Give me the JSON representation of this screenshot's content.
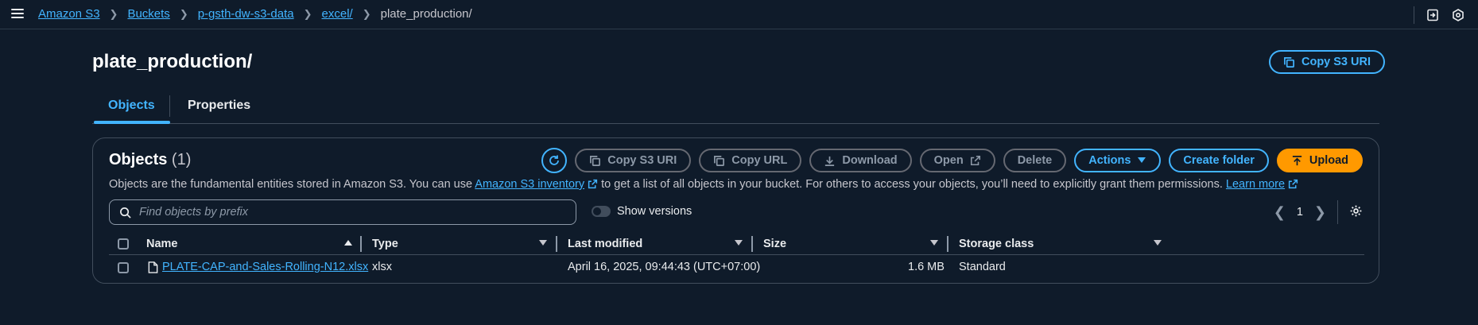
{
  "breadcrumbs": [
    {
      "label": "Amazon S3"
    },
    {
      "label": "Buckets"
    },
    {
      "label": "p-gsth-dw-s3-data"
    },
    {
      "label": "excel/"
    },
    {
      "label": "plate_production/"
    }
  ],
  "page": {
    "title": "plate_production/",
    "copy_s3_uri": "Copy S3 URI"
  },
  "tabs": [
    {
      "label": "Objects",
      "active": true
    },
    {
      "label": "Properties",
      "active": false
    }
  ],
  "objects_panel": {
    "title": "Objects",
    "count": "(1)",
    "toolbar": {
      "copy_s3_uri": "Copy S3 URI",
      "copy_url": "Copy URL",
      "download": "Download",
      "open": "Open",
      "delete": "Delete",
      "actions": "Actions",
      "create_folder": "Create folder",
      "upload": "Upload"
    },
    "description": {
      "part1": "Objects are the fundamental entities stored in Amazon S3. You can use ",
      "link1": "Amazon S3 inventory",
      "part2": " to get a list of all objects in your bucket. For others to access your objects, you’ll need to explicitly grant them permissions. ",
      "link2": "Learn more"
    },
    "search_placeholder": "Find objects by prefix",
    "show_versions": "Show versions",
    "page_number": "1"
  },
  "table": {
    "columns": [
      "Name",
      "Type",
      "Last modified",
      "Size",
      "Storage class"
    ],
    "rows": [
      {
        "name": "PLATE-CAP-and-Sales-Rolling-N12.xlsx",
        "type": "xlsx",
        "last_modified": "April 16, 2025, 09:44:43 (UTC+07:00)",
        "size": "1.6 MB",
        "storage_class": "Standard"
      }
    ]
  },
  "colors": {
    "background": "#0f1b2a",
    "link": "#42b4ff",
    "primary": "#ff9900",
    "border": "#414d5c"
  },
  "icons": [
    "menu-icon",
    "chevron-right-icon",
    "notification-icon",
    "settings-hex-icon",
    "copy-icon",
    "refresh-icon",
    "download-icon",
    "external-link-icon",
    "caret-down-icon",
    "upload-icon",
    "search-icon",
    "file-icon",
    "gear-icon"
  ]
}
